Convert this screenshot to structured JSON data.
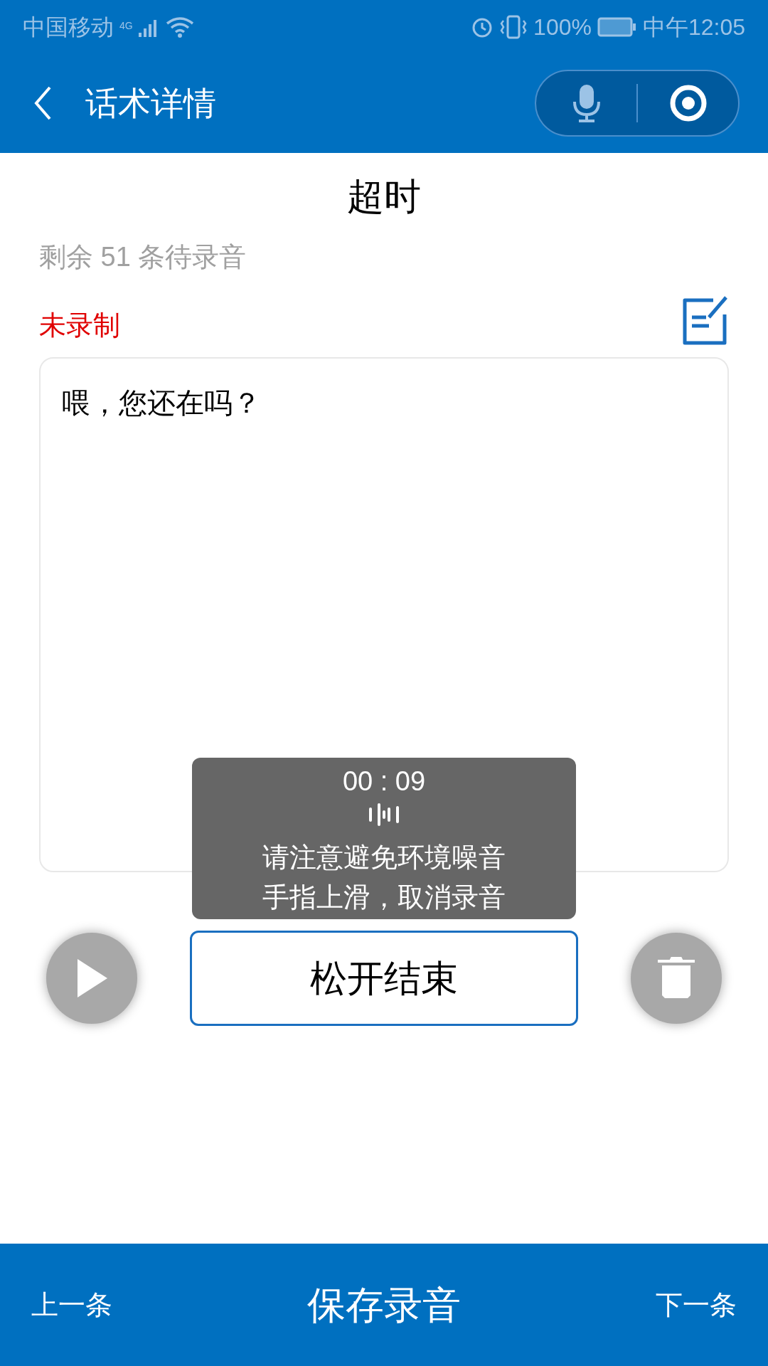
{
  "status_bar": {
    "carrier": "中国移动",
    "network": "4G",
    "battery": "100%",
    "time": "中午12:05"
  },
  "header": {
    "title": "话术详情"
  },
  "script_title": "超时",
  "remaining": "剩余 51 条待录音",
  "record_status": "未录制",
  "script_text": "喂，您还在吗？",
  "toast": {
    "timer": "00 : 09",
    "lines": [
      "请注意避免环境噪音",
      "手指上滑，取消录音"
    ]
  },
  "hold_button": "松开结束",
  "bottom_bar": {
    "prev": "上一条",
    "save": "保存录音",
    "next": "下一条"
  }
}
